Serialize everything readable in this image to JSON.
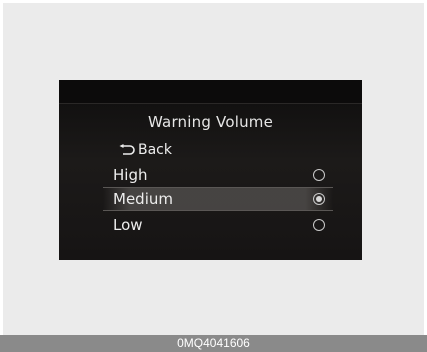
{
  "screen": {
    "title": "Warning Volume",
    "back": {
      "label": "Back",
      "icon": "back-arrow-icon"
    },
    "options": [
      {
        "label": "High",
        "selected": false
      },
      {
        "label": "Medium",
        "selected": true
      },
      {
        "label": "Low",
        "selected": false
      }
    ]
  },
  "caption": "0MQ4041606",
  "colors": {
    "screen_background": "#161414",
    "text": "#ededed",
    "highlight": "#4e4b49"
  }
}
